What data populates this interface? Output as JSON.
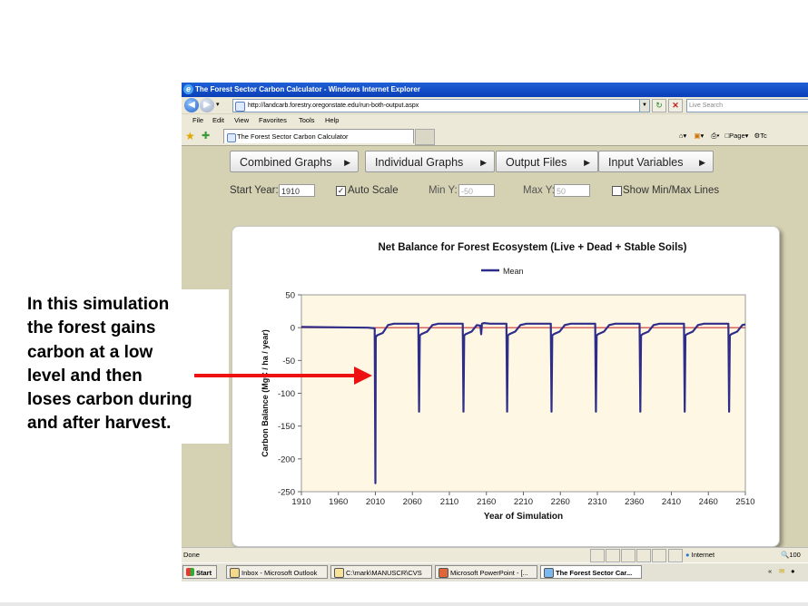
{
  "browser": {
    "window_title": "The Forest Sector Carbon Calculator - Windows Internet Explorer",
    "address": "http://landcarb.forestry.oregonstate.edu/run-both-output.aspx",
    "search_placeholder": "Live Search",
    "menu": [
      "File",
      "Edit",
      "View",
      "Favorites",
      "Tools",
      "Help"
    ],
    "tab_title": "The Forest Sector Carbon Calculator",
    "page_menu": "Page",
    "tools_menu": "Tc",
    "status_left": "Done",
    "status_zone": "Internet",
    "zoom": "100"
  },
  "app": {
    "menu_buttons": [
      "Combined Graphs",
      "Individual Graphs",
      "Output Files",
      "Input Variables"
    ],
    "start_year_label": "Start Year:",
    "start_year_value": "1910",
    "auto_scale_label": "Auto Scale",
    "auto_scale_checked": true,
    "min_y_label": "Min Y:",
    "min_y_value": "-50",
    "max_y_label": "Max Y:",
    "max_y_value": "50",
    "show_minmax_label": "Show Min/Max Lines",
    "show_minmax_checked": false
  },
  "taskbar": {
    "start": "Start",
    "items": [
      "Inbox - Microsoft Outlook",
      "C:\\mark\\MANUSCR\\CVS",
      "Microsoft PowerPoint - [...",
      "The Forest Sector Car..."
    ],
    "active_index": 3
  },
  "callout": {
    "text": "In this simulation\nthe forest gains\ncarbon at a low\nlevel and then\nloses carbon during\nand after harvest."
  },
  "chart_data": {
    "type": "line",
    "title": "Net Balance for Forest Ecosystem (Live + Dead + Stable Soils)",
    "xlabel": "Year of Simulation",
    "ylabel": "Carbon Balance (MgC / ha / year)",
    "xlim": [
      1910,
      2510
    ],
    "ylim": [
      -250,
      50
    ],
    "xticks": [
      1910,
      1960,
      2010,
      2060,
      2110,
      2160,
      2210,
      2260,
      2310,
      2360,
      2410,
      2460,
      2510
    ],
    "yticks": [
      50,
      0,
      -50,
      -100,
      -150,
      -200,
      -250
    ],
    "legend": "top-center",
    "grid": false,
    "zero_line_color": "#cc3333",
    "series_color": "#2e2e8a",
    "series": [
      {
        "name": "Mean",
        "x": [
          1910,
          2000,
          2009,
          2010,
          2010.5,
          2012,
          2020,
          2027,
          2035,
          2068,
          2069,
          2070,
          2072,
          2080,
          2087,
          2095,
          2128,
          2129,
          2130,
          2132,
          2140,
          2147,
          2152,
          2153,
          2154,
          2157,
          2165,
          2187,
          2188,
          2189,
          2191,
          2199,
          2206,
          2214,
          2247,
          2248,
          2249,
          2251,
          2259,
          2266,
          2274,
          2307,
          2308,
          2309,
          2311,
          2319,
          2326,
          2334,
          2367,
          2368,
          2369,
          2371,
          2379,
          2386,
          2394,
          2427,
          2428,
          2429,
          2431,
          2439,
          2446,
          2454,
          2487,
          2488,
          2489,
          2491,
          2499,
          2506,
          2510
        ],
        "y": [
          1,
          0,
          -1,
          -237,
          -15,
          -12,
          -8,
          4,
          6,
          6,
          -128,
          -12,
          -10,
          -6,
          4,
          6,
          6,
          -128,
          -12,
          -10,
          -6,
          4,
          3,
          -10,
          6,
          7,
          6,
          6,
          -128,
          -12,
          -10,
          -6,
          4,
          6,
          6,
          -128,
          -12,
          -10,
          -6,
          4,
          6,
          6,
          -128,
          -12,
          -10,
          -6,
          4,
          6,
          6,
          -128,
          -12,
          -10,
          -6,
          4,
          6,
          6,
          -128,
          -12,
          -10,
          -6,
          4,
          6,
          6,
          -128,
          -12,
          -10,
          -6,
          4,
          5
        ]
      }
    ]
  }
}
